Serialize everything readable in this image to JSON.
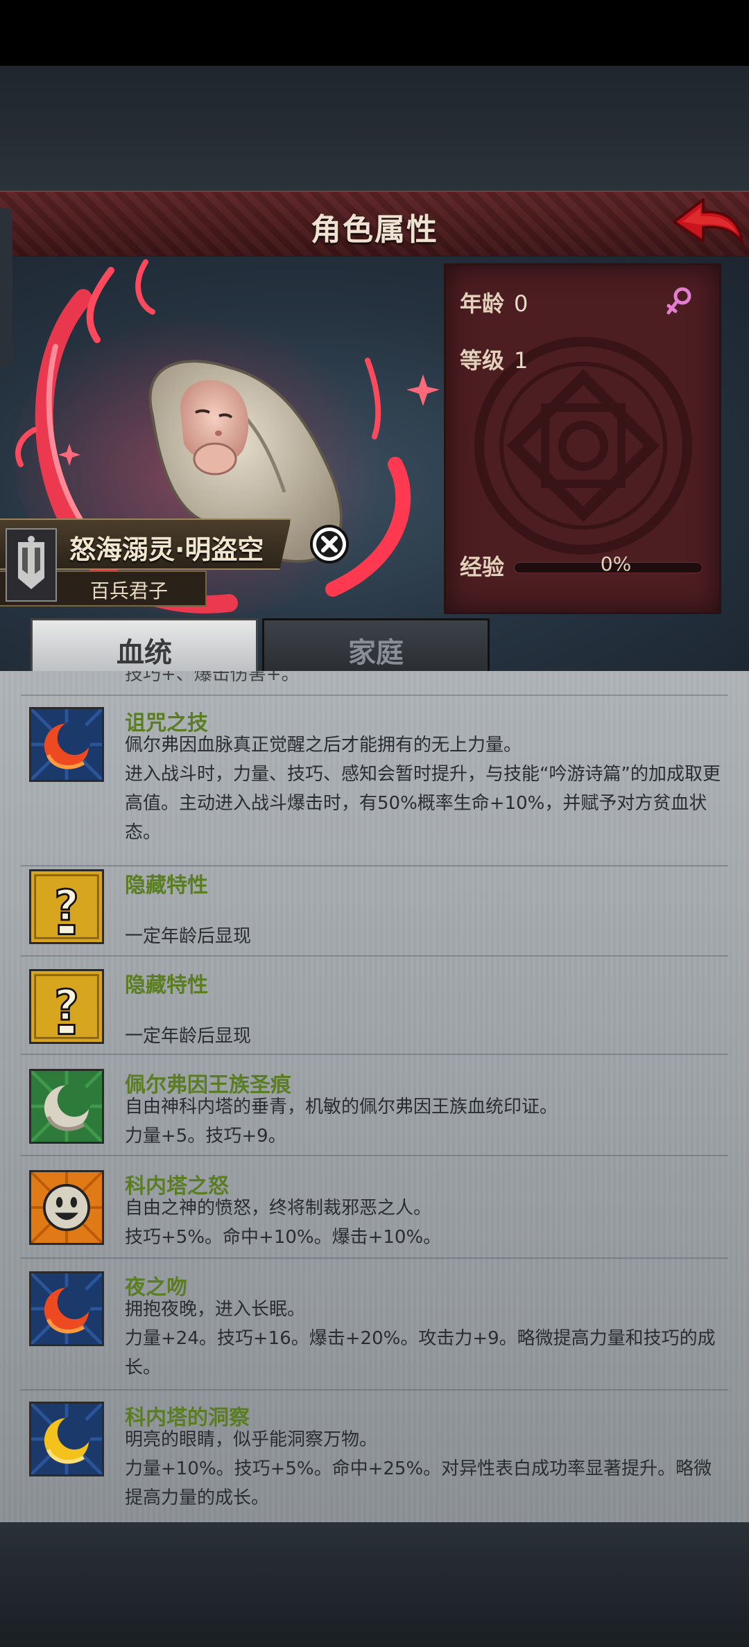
{
  "header": {
    "title": "角色属性"
  },
  "character": {
    "name": "怒海溺灵·明盗空",
    "title": "百兵君子"
  },
  "stats": {
    "age_label": "年龄",
    "age_value": "0",
    "level_label": "等级",
    "level_value": "1",
    "exp_label": "经验",
    "exp_value": "0%",
    "exp_fraction": 0
  },
  "tabs": [
    {
      "label": "血统",
      "selected": true
    },
    {
      "label": "家庭",
      "selected": false
    }
  ],
  "partial_text": "技巧+、爆击伤害+。",
  "traits": [
    {
      "icon": "red-crescent-icon",
      "title": "诅咒之技",
      "title_color": "#5a7d22",
      "desc": "佩尔弗因血脉真正觉醒之后才能拥有的无上力量。\n进入战斗时，力量、技巧、感知会暂时提升，与技能“吟游诗篇”的加成取更高值。主动进入战斗爆击时，有50%概率生命+10%，并赋予对方贫血状态。"
    },
    {
      "icon": "question-mark-icon",
      "title": "隐藏特性",
      "title_color": "#5a7d22",
      "desc": "\n一定年龄后显现"
    },
    {
      "icon": "question-mark-icon",
      "title": "隐藏特性",
      "title_color": "#5a7d22",
      "desc": "\n一定年龄后显现"
    },
    {
      "icon": "white-crescent-icon",
      "title": "佩尔弗因王族圣痕",
      "title_color": "#5a7d22",
      "desc": "自由神科内塔的垂青，机敏的佩尔弗因王族血统印证。\n力量+5。技巧+9。"
    },
    {
      "icon": "smiley-face-icon",
      "title": "科内塔之怒",
      "title_color": "#5a7d22",
      "desc": "自由之神的愤怒，终将制裁邪恶之人。\n技巧+5%。命中+10%。爆击+10%。"
    },
    {
      "icon": "red-crescent-icon",
      "title": "夜之吻",
      "title_color": "#5a7d22",
      "desc": "拥抱夜晚，进入长眠。\n力量+24。技巧+16。爆击+20%。攻击力+9。略微提高力量和技巧的成长。"
    },
    {
      "icon": "yellow-crescent-icon",
      "title": "科内塔的洞察",
      "title_color": "#5a7d22",
      "desc": "明亮的眼睛，似乎能洞察万物。\n力量+10%。技巧+5%。命中+25%。对异性表白成功率显著提升。略微提高力量的成长。"
    }
  ]
}
